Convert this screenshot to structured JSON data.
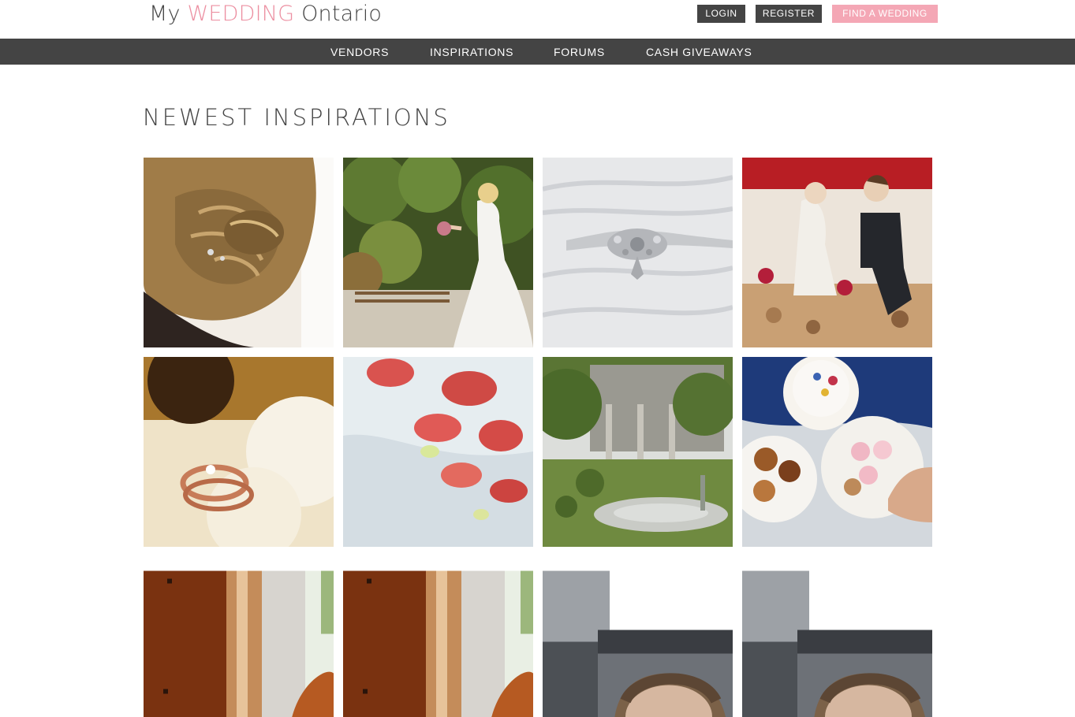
{
  "header": {
    "logo": {
      "prefix": "My",
      "accent": "WEDDING",
      "suffix": "Ontario"
    },
    "buttons": {
      "login": "LOGIN",
      "register": "REGISTER",
      "find_wedding": "FIND A WEDDING"
    }
  },
  "nav": {
    "items": [
      "VENDORS",
      "INSPIRATIONS",
      "FORUMS",
      "CASH GIVEAWAYS"
    ]
  },
  "main": {
    "title": "NEWEST INSPIRATIONS",
    "tiles": [
      {
        "subject": "bridal-updo-hair"
      },
      {
        "subject": "bride-walking-garden"
      },
      {
        "subject": "dress-jewelled-belt"
      },
      {
        "subject": "cake-topper-couple"
      },
      {
        "subject": "wedding-rings"
      },
      {
        "subject": "cake-with-petals"
      },
      {
        "subject": "estate-garden"
      },
      {
        "subject": "cake-and-cupcakes"
      },
      {
        "subject": "wooden-beams-dog"
      },
      {
        "subject": "wooden-beams-dog"
      },
      {
        "subject": "car-selfie"
      },
      {
        "subject": "car-selfie"
      }
    ]
  },
  "colors": {
    "accent_pink": "#ec8fa1",
    "dark_bar": "#444444",
    "button_pink": "#f4a7b5"
  }
}
